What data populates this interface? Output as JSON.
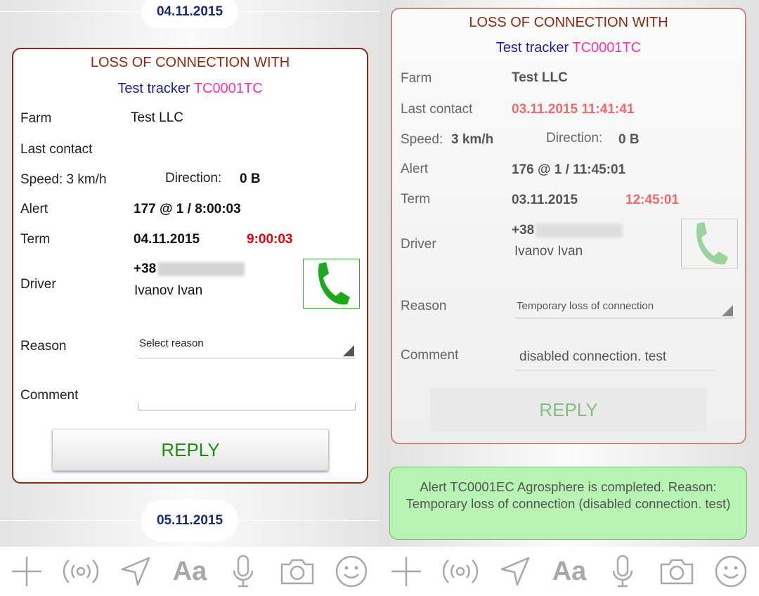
{
  "left": {
    "date_top": "04.11.2015",
    "date_bottom": "05.11.2015",
    "card": {
      "title": "LOSS OF CONNECTION WITH",
      "tracker_label": "Test tracker",
      "tracker_id": "TC0001TC",
      "farm_label": "Farm",
      "farm_value": "Test LLC",
      "last_contact_label": "Last contact",
      "speed_label": "Speed: 3 km/h",
      "direction_label": "Direction:",
      "direction_value": "0 B",
      "alert_label": "Alert",
      "alert_value": "177 @ 1 / 8:00:03",
      "term_label": "Term",
      "term_date": "04.11.2015",
      "term_time": "9:00:03",
      "driver_label": "Driver",
      "driver_phone_prefix": "+38",
      "driver_name": "Ivanov Ivan",
      "reason_label": "Reason",
      "reason_value": "Select reason",
      "comment_label": "Comment",
      "comment_value": "",
      "reply_label": "REPLY"
    }
  },
  "right": {
    "card": {
      "title": "LOSS OF CONNECTION WITH",
      "tracker_label": "Test tracker",
      "tracker_id": "TC0001TC",
      "farm_label": "Farm",
      "farm_value": "Test LLC",
      "last_contact_label": "Last contact",
      "last_contact_value": "03.11.2015 11:41:41",
      "speed_label": "Speed:",
      "speed_value": "3 km/h",
      "direction_label": "Direction:",
      "direction_value": "0 B",
      "alert_label": "Alert",
      "alert_value": "176 @ 1 / 11:45:01",
      "term_label": "Term",
      "term_date": "03.11.2015",
      "term_time": "12:45:01",
      "driver_label": "Driver",
      "driver_phone_prefix": "+38",
      "driver_name": "Ivanov Ivan",
      "reason_label": "Reason",
      "reason_value": "Temporary loss of connection",
      "comment_label": "Comment",
      "comment_value": "disabled connection. test",
      "reply_label": "REPLY"
    },
    "alert_message": "Alert TC0001EC Agrosphere is completed. Reason: Temporary loss of connection (disabled connection. test)"
  },
  "toolbar": {
    "icons": [
      "plus-icon",
      "broadcast-icon",
      "location-arrow-icon",
      "font-icon",
      "microphone-icon",
      "camera-icon",
      "smiley-icon"
    ],
    "font_label": "Aa"
  },
  "colors": {
    "title": "#8b2a14",
    "tracker": "#1e1e9a",
    "tracker_id": "#ff33aa",
    "reply_left": "#1f8c12",
    "alert_bubble": "#b7f4b3"
  }
}
